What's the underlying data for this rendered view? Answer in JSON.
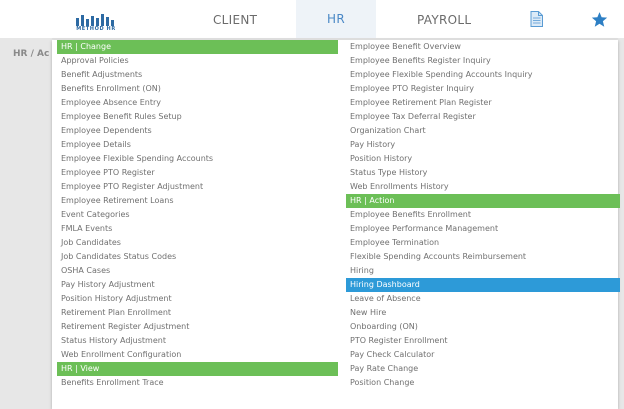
{
  "colors": {
    "section_header_bg": "#6cbf57",
    "selected_bg": "#2d9ad8",
    "nav_active": "#4a88c6",
    "star": "#2d7fc4",
    "text": "#707070"
  },
  "logo": {
    "text": "METHOD HR",
    "icon": "bar-logo-icon"
  },
  "nav": {
    "client": "CLIENT",
    "hr": "HR",
    "payroll": "PAYROLL",
    "doc_icon": "document-icon",
    "star_icon": "star-icon"
  },
  "background": {
    "breadcrumb": "HR / Ac"
  },
  "menu": {
    "left": [
      {
        "label": "HR | Change",
        "type": "header"
      },
      {
        "label": "Approval Policies"
      },
      {
        "label": "Benefit Adjustments"
      },
      {
        "label": "Benefits Enrollment (ON)"
      },
      {
        "label": "Employee Absence Entry"
      },
      {
        "label": "Employee Benefit Rules Setup"
      },
      {
        "label": "Employee Dependents"
      },
      {
        "label": "Employee Details"
      },
      {
        "label": "Employee Flexible Spending Accounts"
      },
      {
        "label": "Employee PTO Register"
      },
      {
        "label": "Employee PTO Register Adjustment"
      },
      {
        "label": "Employee Retirement Loans"
      },
      {
        "label": "Event Categories"
      },
      {
        "label": "FMLA Events"
      },
      {
        "label": "Job Candidates"
      },
      {
        "label": "Job Candidates Status Codes"
      },
      {
        "label": "OSHA Cases"
      },
      {
        "label": "Pay History Adjustment"
      },
      {
        "label": "Position History Adjustment"
      },
      {
        "label": "Retirement Plan Enrollment"
      },
      {
        "label": "Retirement Register Adjustment"
      },
      {
        "label": "Status History Adjustment"
      },
      {
        "label": "Web Enrollment Configuration"
      },
      {
        "label": "HR | View",
        "type": "header"
      },
      {
        "label": "Benefits Enrollment Trace"
      }
    ],
    "right": [
      {
        "label": "Employee Benefit Overview"
      },
      {
        "label": "Employee Benefits Register Inquiry"
      },
      {
        "label": "Employee Flexible Spending Accounts Inquiry"
      },
      {
        "label": "Employee PTO Register Inquiry"
      },
      {
        "label": "Employee Retirement Plan Register"
      },
      {
        "label": "Employee Tax Deferral Register"
      },
      {
        "label": "Organization Chart"
      },
      {
        "label": "Pay History"
      },
      {
        "label": "Position History"
      },
      {
        "label": "Status Type History"
      },
      {
        "label": "Web Enrollments History"
      },
      {
        "label": "HR | Action",
        "type": "header"
      },
      {
        "label": "Employee Benefits Enrollment"
      },
      {
        "label": "Employee Performance Management"
      },
      {
        "label": "Employee Termination"
      },
      {
        "label": "Flexible Spending Accounts Reimbursement"
      },
      {
        "label": "Hiring"
      },
      {
        "label": "Hiring Dashboard",
        "type": "selected"
      },
      {
        "label": "Leave of Absence"
      },
      {
        "label": "New Hire"
      },
      {
        "label": "Onboarding (ON)"
      },
      {
        "label": "PTO Register Enrollment"
      },
      {
        "label": "Pay Check Calculator"
      },
      {
        "label": "Pay Rate Change"
      },
      {
        "label": "Position Change"
      }
    ]
  }
}
